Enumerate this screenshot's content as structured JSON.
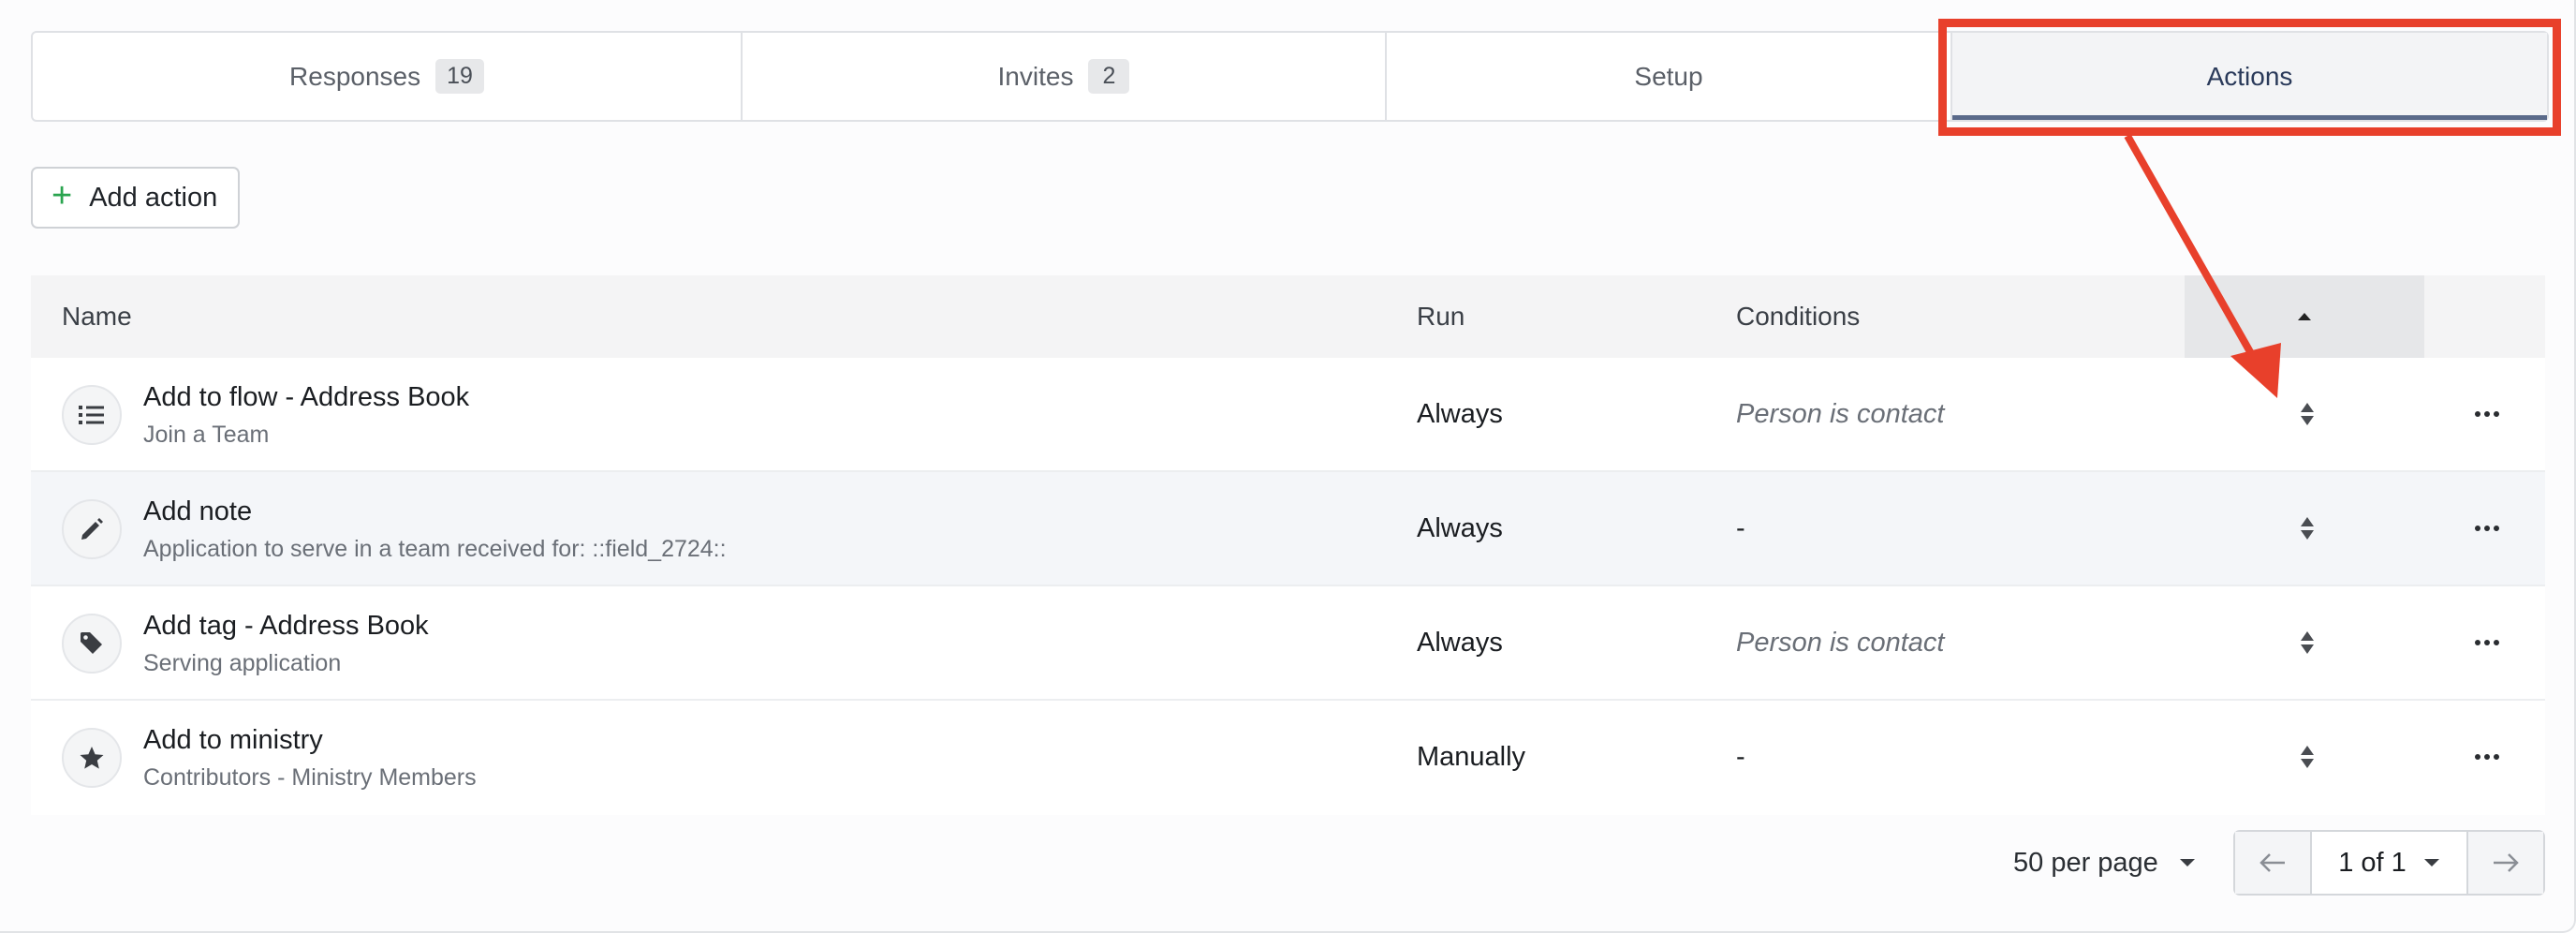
{
  "tabs": [
    {
      "label": "Responses",
      "count": "19"
    },
    {
      "label": "Invites",
      "count": "2"
    },
    {
      "label": "Setup"
    },
    {
      "label": "Actions",
      "active": true
    }
  ],
  "toolbar": {
    "add_action_label": "Add action"
  },
  "table": {
    "headers": {
      "name": "Name",
      "run": "Run",
      "conditions": "Conditions"
    },
    "rows": [
      {
        "icon": "list-icon",
        "title": "Add to flow - Address Book",
        "subtitle": "Join a Team",
        "run": "Always",
        "conditions": "Person is contact"
      },
      {
        "icon": "pencil-icon",
        "title": "Add note",
        "subtitle": "Application to serve in a team received for: ::field_2724::",
        "run": "Always",
        "conditions": "-"
      },
      {
        "icon": "tag-icon",
        "title": "Add tag - Address Book",
        "subtitle": "Serving application",
        "run": "Always",
        "conditions": "Person is contact"
      },
      {
        "icon": "star-icon",
        "title": "Add to ministry",
        "subtitle": "Contributors - Ministry Members",
        "run": "Manually",
        "conditions": "-"
      }
    ]
  },
  "pagination": {
    "per_page": "50 per page",
    "page": "1 of 1"
  },
  "colors": {
    "annotation": "#e8402b",
    "accent_green": "#2aa44f",
    "active_tab_underline": "#5a6a8a"
  }
}
